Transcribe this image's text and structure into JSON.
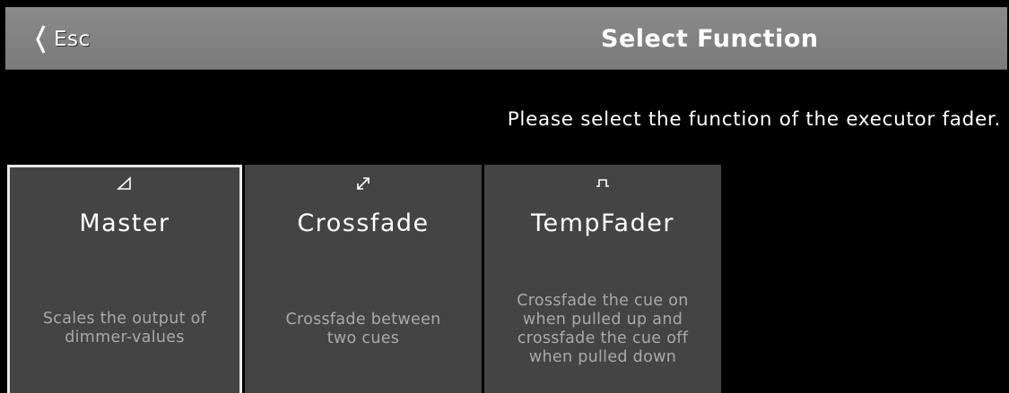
{
  "titlebar": {
    "esc_label": "Esc",
    "title": "Select Function"
  },
  "instruction": "Please select the function of the executor fader.",
  "functions": [
    {
      "title": "Master",
      "icon": "ramp-icon",
      "description": "Scales the output of\ndimmer-values",
      "selected": true
    },
    {
      "title": "Crossfade",
      "icon": "diagonal-arrow-icon",
      "description": "Crossfade between\ntwo cues",
      "selected": false
    },
    {
      "title": "TempFader",
      "icon": "pulse-icon",
      "description": "Crossfade the cue on\nwhen pulled up and\ncrossfade the cue off\nwhen pulled down",
      "selected": false
    }
  ],
  "colors": {
    "titlebar": "#848484",
    "tile": "#444444",
    "description": "#a9a9a9",
    "selected_border": "#e8e8e8"
  }
}
